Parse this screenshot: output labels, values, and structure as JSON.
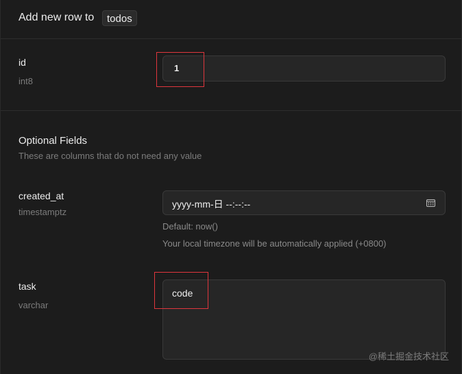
{
  "header": {
    "title": "Add new row to",
    "table_name": "todos"
  },
  "fields": {
    "id": {
      "name": "id",
      "type": "int8",
      "value": "1"
    },
    "created_at": {
      "name": "created_at",
      "type": "timestamptz",
      "value": "yyyy-mm-日 --:--:--",
      "default_hint": "Default: now()",
      "timezone_hint": "Your local timezone will be automatically applied (+0800)"
    },
    "task": {
      "name": "task",
      "type": "varchar",
      "value": "code"
    }
  },
  "optional_section": {
    "title": "Optional Fields",
    "description": "These are columns that do not need any value"
  },
  "watermark": "@稀土掘金技术社区",
  "colors": {
    "background": "#1c1c1c",
    "input_background": "#262626",
    "highlight": "#e0363d"
  }
}
